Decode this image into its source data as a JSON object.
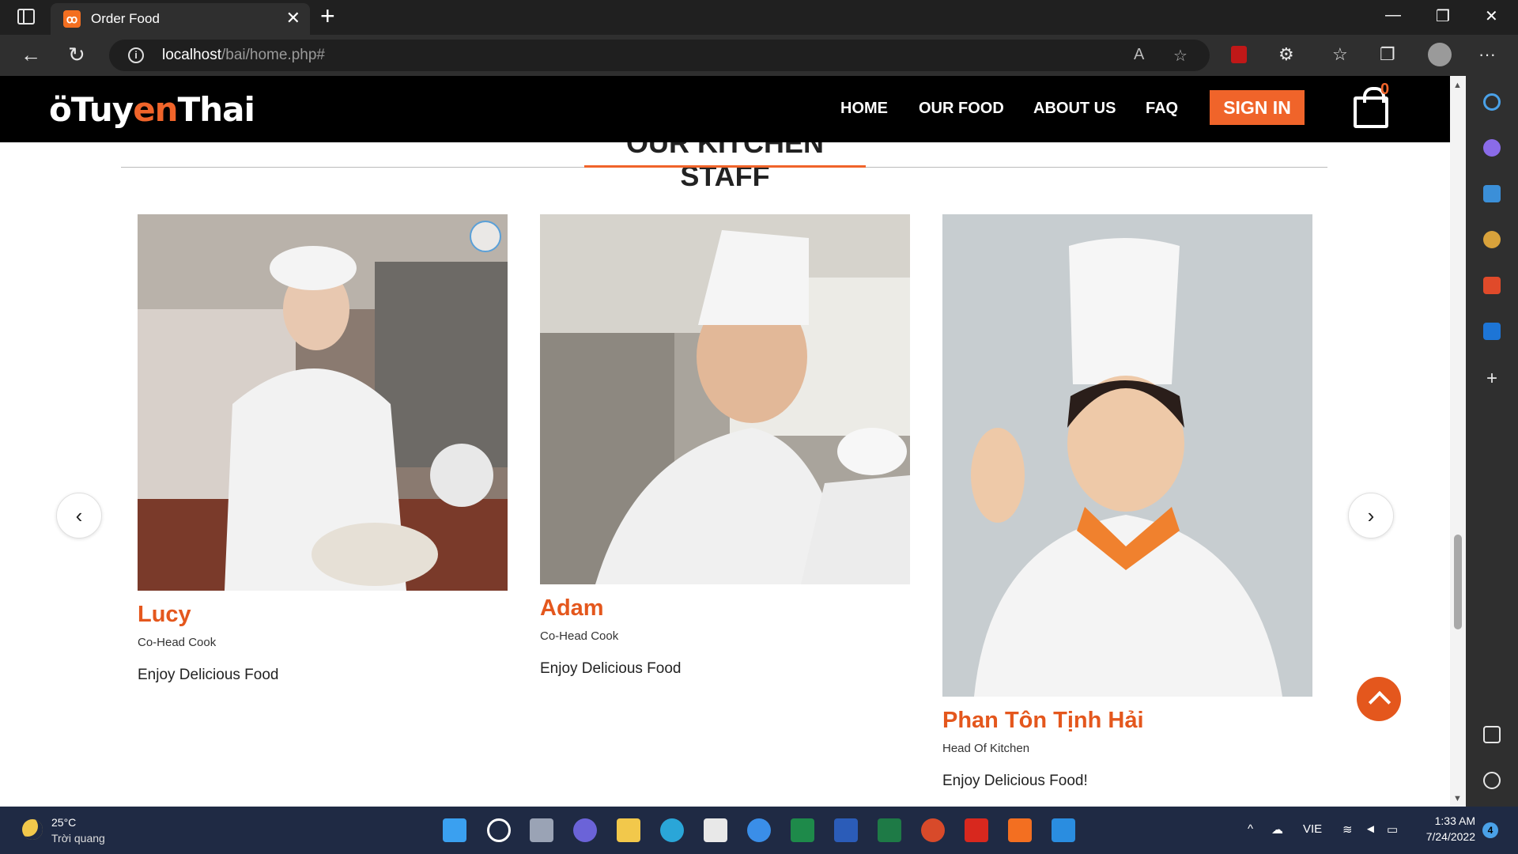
{
  "browser": {
    "tab_title": "Order Food",
    "tab_favicon": "xampp-icon",
    "url_host": "localhost",
    "url_path": "/bai/home.php#",
    "tab_close": "✕",
    "new_tab": "+",
    "win_minimize": "—",
    "win_restore": "❐",
    "win_close": "✕"
  },
  "site": {
    "logo_prefix": "Tuy",
    "logo_accent": "en",
    "logo_suffix": "Thai",
    "logo_glyph": "ö",
    "nav": [
      "HOME",
      "OUR FOOD",
      "ABOUT US",
      "FAQ"
    ],
    "signin_label": "SIGN IN",
    "cart_count": "0",
    "accent_color": "#f0642a"
  },
  "section": {
    "title": "OUR KITCHEN STAFF"
  },
  "staff": [
    {
      "name": "Lucy",
      "role": "Co-Head Cook",
      "desc": "Enjoy Delicious Food"
    },
    {
      "name": "Adam",
      "role": "Co-Head Cook",
      "desc": "Enjoy Delicious Food"
    },
    {
      "name": "Phan Tôn Tịnh Hải",
      "role": "Head Of Kitchen",
      "desc": "Enjoy Delicious Food!"
    }
  ],
  "carousel": {
    "prev": "‹",
    "next": "›"
  },
  "taskbar": {
    "temperature": "25°C",
    "weather": "Trời quang",
    "language": "VIE",
    "time": "1:33 AM",
    "date": "7/24/2022",
    "notifications": "4"
  }
}
